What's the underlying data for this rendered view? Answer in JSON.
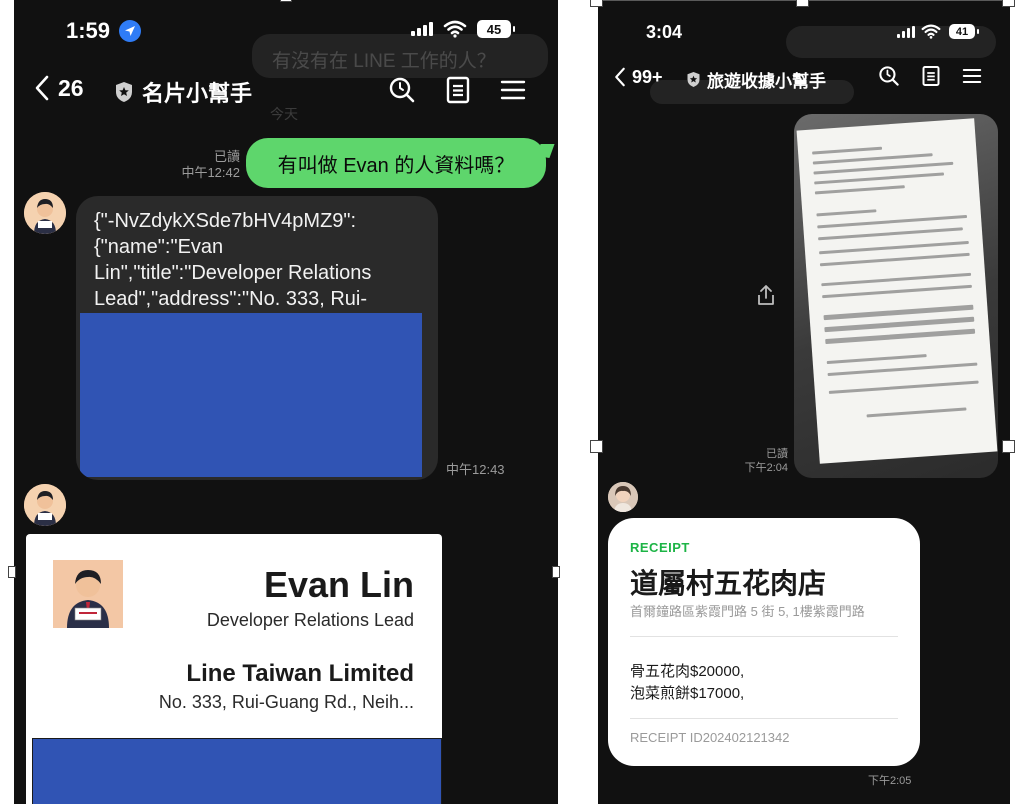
{
  "left_phone": {
    "status": {
      "time": "1:59",
      "battery": "45"
    },
    "nav": {
      "back_count": "26",
      "title": "名片小幫手"
    },
    "ghost_text": "有沒有在 LINE 工作的人？",
    "ghost_day": "今天",
    "user_message": {
      "read": "已讀",
      "time": "中午12:42",
      "text": "有叫做 Evan 的人資料嗎？"
    },
    "json_reply": {
      "line1": "{\"-NvZdykXSde7bHV4pMZ9\":",
      "line2": "{\"name\":\"Evan",
      "line3": "Lin\",\"title\":\"Developer Relations",
      "line4": "Lead\",\"address\":\"No. 333, Rui-",
      "time": "中午12:43"
    },
    "card": {
      "name": "Evan Lin",
      "title": "Developer Relations Lead",
      "company": "Line Taiwan Limited",
      "address": "No. 333, Rui-Guang Rd., Neih..."
    }
  },
  "right_phone": {
    "status": {
      "time": "3:04",
      "battery": "41"
    },
    "nav": {
      "back_count": "99+",
      "title": "旅遊收據小幫手"
    },
    "photo_message": {
      "read": "已讀",
      "time": "下午2:04"
    },
    "receipt_card": {
      "label": "RECEIPT",
      "store": "道屬村五花肉店",
      "address": "首爾鐘路區紫霞門路 5 街 5, 1樓紫霞門路",
      "items": [
        "骨五花肉$20000,",
        "泡菜煎餅$17000,"
      ],
      "receipt_id": "RECEIPT ID202402121342",
      "time": "下午2:05"
    }
  },
  "colors": {
    "chat_background": "#111111",
    "user_bubble": "#5ed66c",
    "bot_bubble": "#2a2a2a",
    "redaction": "#3054b4",
    "receipt_accent": "#1db446"
  }
}
